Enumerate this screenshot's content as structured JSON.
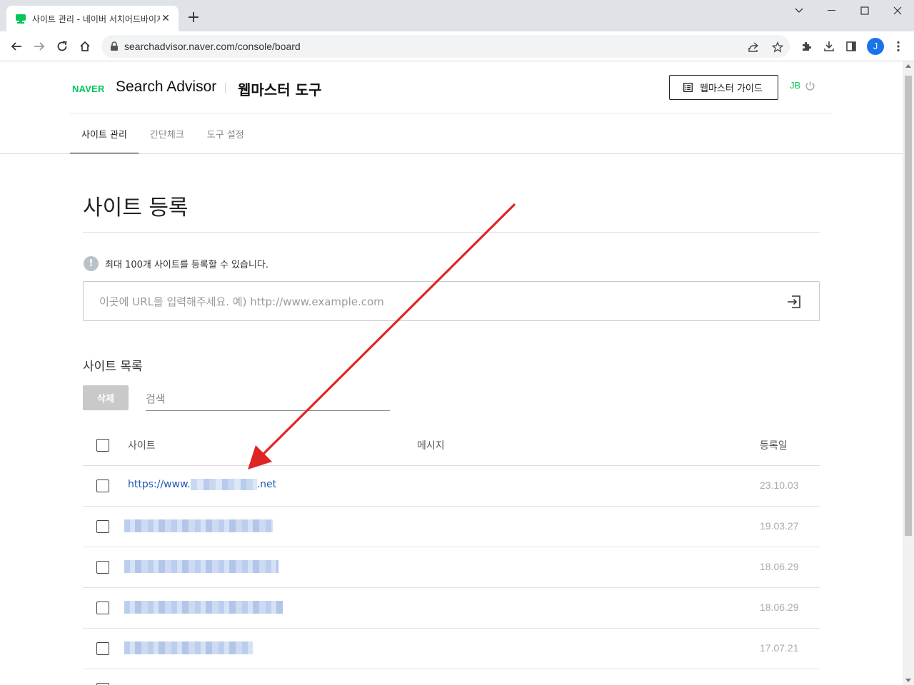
{
  "browser": {
    "tab_title": "사이트 관리 - 네이버 서치어드바이저",
    "url": "searchadvisor.naver.com/console/board",
    "profile_initial": "J"
  },
  "header": {
    "logo": "NAVER",
    "brand": "Search Advisor",
    "subtitle": "웹마스터 도구",
    "guide_button": "웹마스터 가이드",
    "user": "JB"
  },
  "tabs": [
    {
      "label": "사이트 관리",
      "active": true
    },
    {
      "label": "간단체크",
      "active": false
    },
    {
      "label": "도구 설정",
      "active": false
    }
  ],
  "main": {
    "title": "사이트 등록",
    "notice": "최대 100개 사이트를 등록할 수 있습니다.",
    "url_placeholder": "이곳에 URL을 입력해주세요. 예) http://www.example.com",
    "list_title": "사이트 목록",
    "delete_button": "삭제",
    "search_placeholder": "검색"
  },
  "table": {
    "columns": [
      "사이트",
      "메시지",
      "등록일"
    ],
    "rows": [
      {
        "site_prefix": "https://www.",
        "site_suffix": ".net",
        "date": "23.10.03"
      },
      {
        "site_prefix": "",
        "site_suffix": "",
        "date": "19.03.27"
      },
      {
        "site_prefix": "",
        "site_suffix": "",
        "date": "18.06.29"
      },
      {
        "site_prefix": "",
        "site_suffix": "",
        "date": "18.06.29"
      },
      {
        "site_prefix": "",
        "site_suffix": "",
        "date": "17.07.21"
      }
    ]
  },
  "colors": {
    "naver_green": "#03c75a",
    "link_blue": "#1c58b4",
    "annotation_arrow": "#e02424"
  }
}
